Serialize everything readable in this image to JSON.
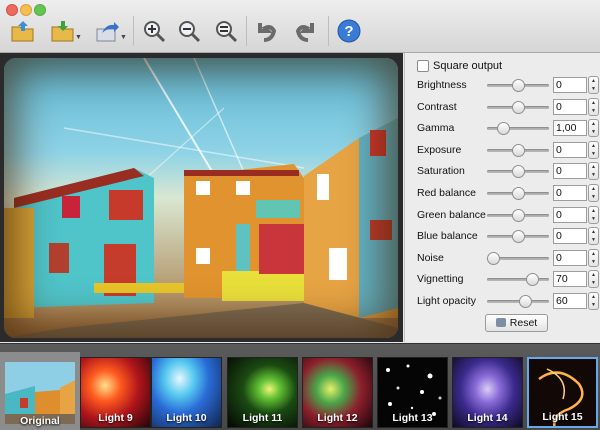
{
  "toolbar": {
    "icons": [
      "open-folder-icon",
      "save-folder-icon",
      "share-icon",
      "zoom-in-icon",
      "zoom-out-icon",
      "zoom-fit-icon",
      "rotate-left-icon",
      "rotate-right-icon",
      "help-icon"
    ]
  },
  "panel": {
    "square_output_label": "Square output",
    "sliders": [
      {
        "label": "Brightness",
        "value": "0",
        "fraction": 0.5
      },
      {
        "label": "Contrast",
        "value": "0",
        "fraction": 0.5
      },
      {
        "label": "Gamma",
        "value": "1,00",
        "fraction": 0.25
      },
      {
        "label": "Exposure",
        "value": "0",
        "fraction": 0.5
      },
      {
        "label": "Saturation",
        "value": "0",
        "fraction": 0.5
      },
      {
        "label": "Red balance",
        "value": "0",
        "fraction": 0.5
      },
      {
        "label": "Green balance",
        "value": "0",
        "fraction": 0.5
      },
      {
        "label": "Blue balance",
        "value": "0",
        "fraction": 0.5
      },
      {
        "label": "Noise",
        "value": "0",
        "fraction": 0.1
      },
      {
        "label": "Vignetting",
        "value": "70",
        "fraction": 0.72
      },
      {
        "label": "Light opacity",
        "value": "60",
        "fraction": 0.62
      }
    ],
    "reset_label": "Reset"
  },
  "thumbnails": [
    {
      "label": "Original",
      "selected": false
    },
    {
      "label": "Light 9",
      "selected": false
    },
    {
      "label": "Light 10",
      "selected": false
    },
    {
      "label": "Light 11",
      "selected": false
    },
    {
      "label": "Light 12",
      "selected": false
    },
    {
      "label": "Light 13",
      "selected": false
    },
    {
      "label": "Light 14",
      "selected": false
    },
    {
      "label": "Light 15",
      "selected": true
    }
  ],
  "colors": {
    "accent": "#63a9ec",
    "help": "#3a7bd5"
  }
}
